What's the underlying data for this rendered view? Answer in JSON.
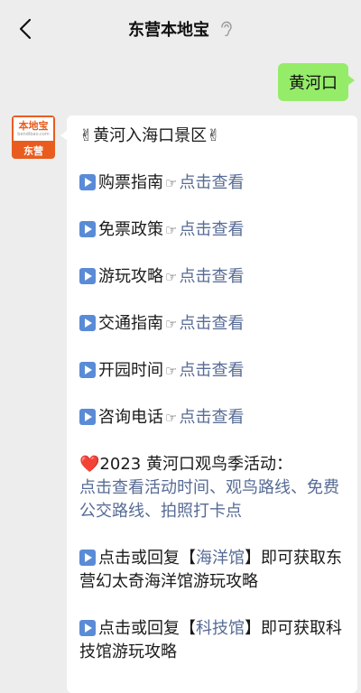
{
  "header": {
    "title": "东营本地宝",
    "back_icon": "back-chevron-icon",
    "ear_icon": "ear-icon"
  },
  "user_message": "黄河口",
  "avatar": {
    "line1": "本地宝",
    "line2": "bendibao.com",
    "line3": "东营"
  },
  "reply": {
    "heading_emoji_left": "✌",
    "heading": "黄河入海口景区",
    "heading_emoji_right": "✌",
    "items": [
      {
        "label": "购票指南",
        "hand": "☞",
        "link": "点击查看"
      },
      {
        "label": "免票政策",
        "hand": "☞",
        "link": "点击查看"
      },
      {
        "label": "游玩攻略",
        "hand": "☞",
        "link": "点击查看"
      },
      {
        "label": "交通指南",
        "hand": "☞",
        "link": "点击查看"
      },
      {
        "label": "开园时间",
        "hand": "☞",
        "link": "点击查看"
      },
      {
        "label": "咨询电话",
        "hand": "☞",
        "link": "点击查看"
      }
    ],
    "event_heart": "❤️",
    "event_title": "2023 黄河口观鸟季活动：",
    "event_link": "点击查看活动时间、观鸟路线、免费公交路线、拍照打卡点",
    "ocean": {
      "prefix": "点击或回复【",
      "keyword": "海洋馆",
      "suffix": "】即可获取东营幻太奇海洋馆游玩攻略"
    },
    "tech": {
      "prefix": "点击或回复【",
      "keyword": "科技馆",
      "suffix": "】即可获取科技馆游玩攻略"
    }
  }
}
